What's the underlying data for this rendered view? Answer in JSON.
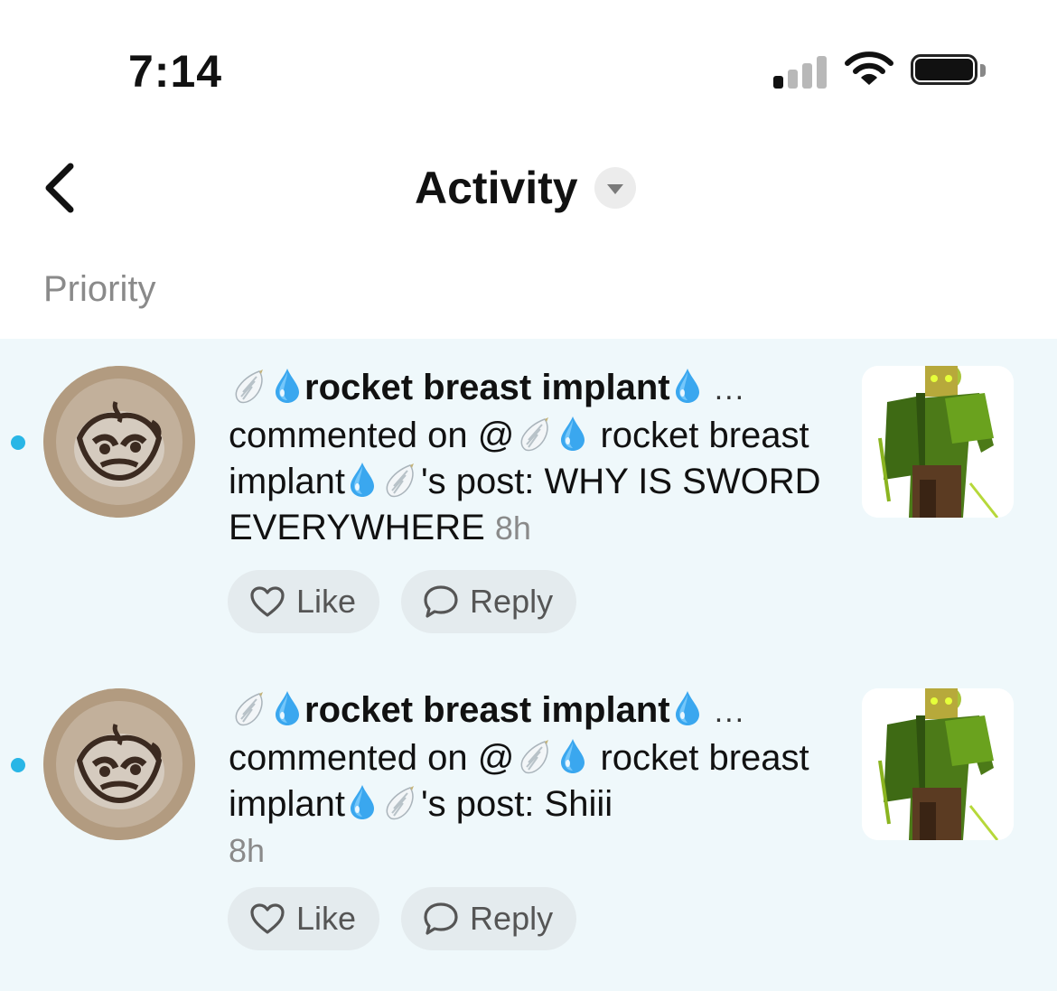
{
  "status_bar": {
    "time": "7:14"
  },
  "header": {
    "title": "Activity"
  },
  "section": {
    "label": "Priority"
  },
  "colors": {
    "unread": "#29b6e6",
    "list_bg": "#eff8fb",
    "button_bg": "#e4ebee",
    "secondary_text": "#8a8a8a"
  },
  "items": [
    {
      "username": "rocket breast implant",
      "more": "...",
      "action": "commented on @",
      "target_name": "rocket breast implant",
      "possessive": "'s post: ",
      "comment": "WHY IS SWORD EVERYWHERE",
      "time": "8h",
      "like_label": "Like",
      "reply_label": "Reply"
    },
    {
      "username": "rocket breast implant",
      "more": "...",
      "action": "commented on @",
      "target_name": "rocket breast implant",
      "possessive": "'s post: ",
      "comment": "Shiii",
      "time": "8h",
      "like_label": "Like",
      "reply_label": "Reply"
    }
  ],
  "icons": [
    "back-chevron-icon",
    "dropdown-triangle-icon",
    "wing-emoji-icon",
    "droplet-emoji-icon",
    "heart-icon",
    "speech-bubble-icon",
    "signal-icon",
    "wifi-icon",
    "battery-icon"
  ]
}
